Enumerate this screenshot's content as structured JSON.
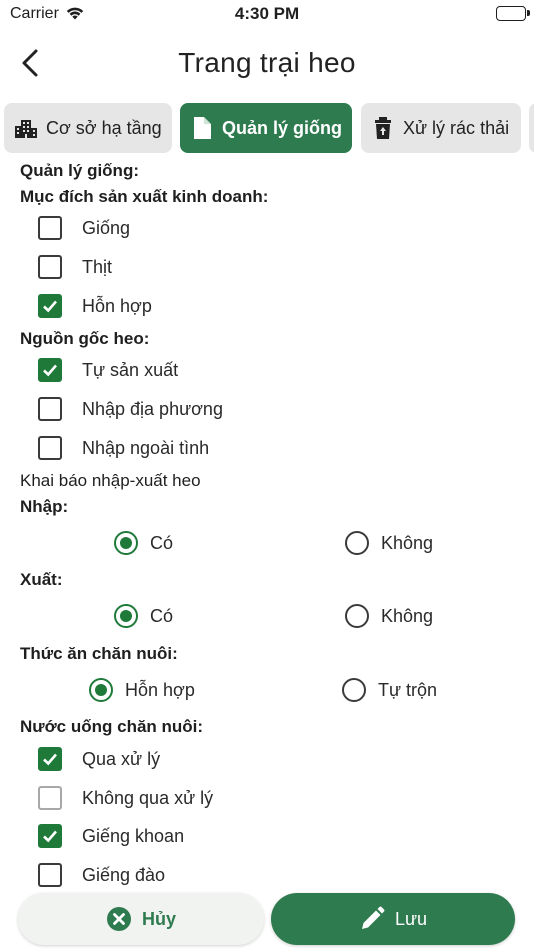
{
  "status_bar": {
    "carrier": "Carrier",
    "time": "4:30 PM"
  },
  "header": {
    "title": "Trang trại heo"
  },
  "tabs": [
    {
      "label": "Cơ sở hạ tầng",
      "icon": "building-icon",
      "active": false
    },
    {
      "label": "Quản lý giống",
      "icon": "document-icon",
      "active": true
    },
    {
      "label": "Xử lý rác thải",
      "icon": "trash-icon",
      "active": false
    }
  ],
  "form": {
    "section_title": "Quản lý giống:",
    "purpose": {
      "title": "Mục đích sản xuất kinh doanh:",
      "options": [
        {
          "label": "Giống",
          "checked": false
        },
        {
          "label": "Thịt",
          "checked": false
        },
        {
          "label": "Hỗn hợp",
          "checked": true
        }
      ]
    },
    "origin": {
      "title": "Nguồn gốc heo:",
      "options": [
        {
          "label": "Tự sản xuất",
          "checked": true
        },
        {
          "label": "Nhập địa phương",
          "checked": false
        },
        {
          "label": "Nhập ngoài tình",
          "checked": false
        }
      ]
    },
    "declaration_title": "Khai báo nhập-xuất heo",
    "import": {
      "title": "Nhập:",
      "options": [
        {
          "label": "Có",
          "selected": true
        },
        {
          "label": "Không",
          "selected": false
        }
      ]
    },
    "export": {
      "title": "Xuất:",
      "options": [
        {
          "label": "Có",
          "selected": true
        },
        {
          "label": "Không",
          "selected": false
        }
      ]
    },
    "feed": {
      "title": "Thức ăn chăn nuôi:",
      "options": [
        {
          "label": "Hỗn hợp",
          "selected": true
        },
        {
          "label": "Tự trộn",
          "selected": false
        }
      ]
    },
    "water": {
      "title": "Nước uống chăn nuôi:",
      "options": [
        {
          "label": "Qua xử lý",
          "checked": true
        },
        {
          "label": "Không qua xử lý",
          "checked": false
        },
        {
          "label": "Giếng khoan",
          "checked": true
        },
        {
          "label": "Giếng đào",
          "checked": false
        }
      ]
    }
  },
  "buttons": {
    "cancel_label": "Hủy",
    "save_label": "Lưu"
  },
  "colors": {
    "primary": "#2f7b50",
    "checkbox_checked": "#1f7a3a",
    "tab_inactive": "#e6e6e6"
  }
}
